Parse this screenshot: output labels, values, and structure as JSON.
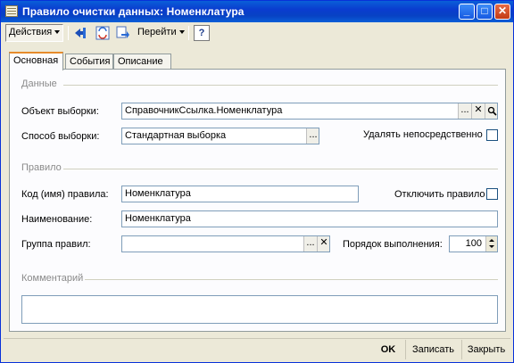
{
  "window": {
    "title": "Правило очистки данных: Номенклатура"
  },
  "toolbar": {
    "actions_label": "Действия",
    "goto_label": "Перейти",
    "help_label": "?"
  },
  "tabs": [
    {
      "label": "Основная",
      "active": true
    },
    {
      "label": "События",
      "active": false
    },
    {
      "label": "Описание",
      "active": false
    }
  ],
  "sections": {
    "data": "Данные",
    "rule": "Правило",
    "comment": "Комментарий"
  },
  "fields": {
    "object_label": "Объект выборки:",
    "object_value": "СправочникСсылка.Номенклатура",
    "method_label": "Способ выборки:",
    "method_value": "Стандартная выборка",
    "delete_directly_label": "Удалять непосредственно",
    "code_label": "Код (имя) правила:",
    "code_value": "Номенклатура",
    "disable_rule_label": "Отключить правило",
    "name_label": "Наименование:",
    "name_value": "Номенклатура",
    "group_label": "Группа правил:",
    "group_value": "",
    "order_label": "Порядок выполнения:",
    "order_value": "100",
    "comment_value": ""
  },
  "buttons": {
    "ok": "OK",
    "save": "Записать",
    "close": "Закрыть",
    "ellipsis": "...",
    "clear": "✕"
  }
}
